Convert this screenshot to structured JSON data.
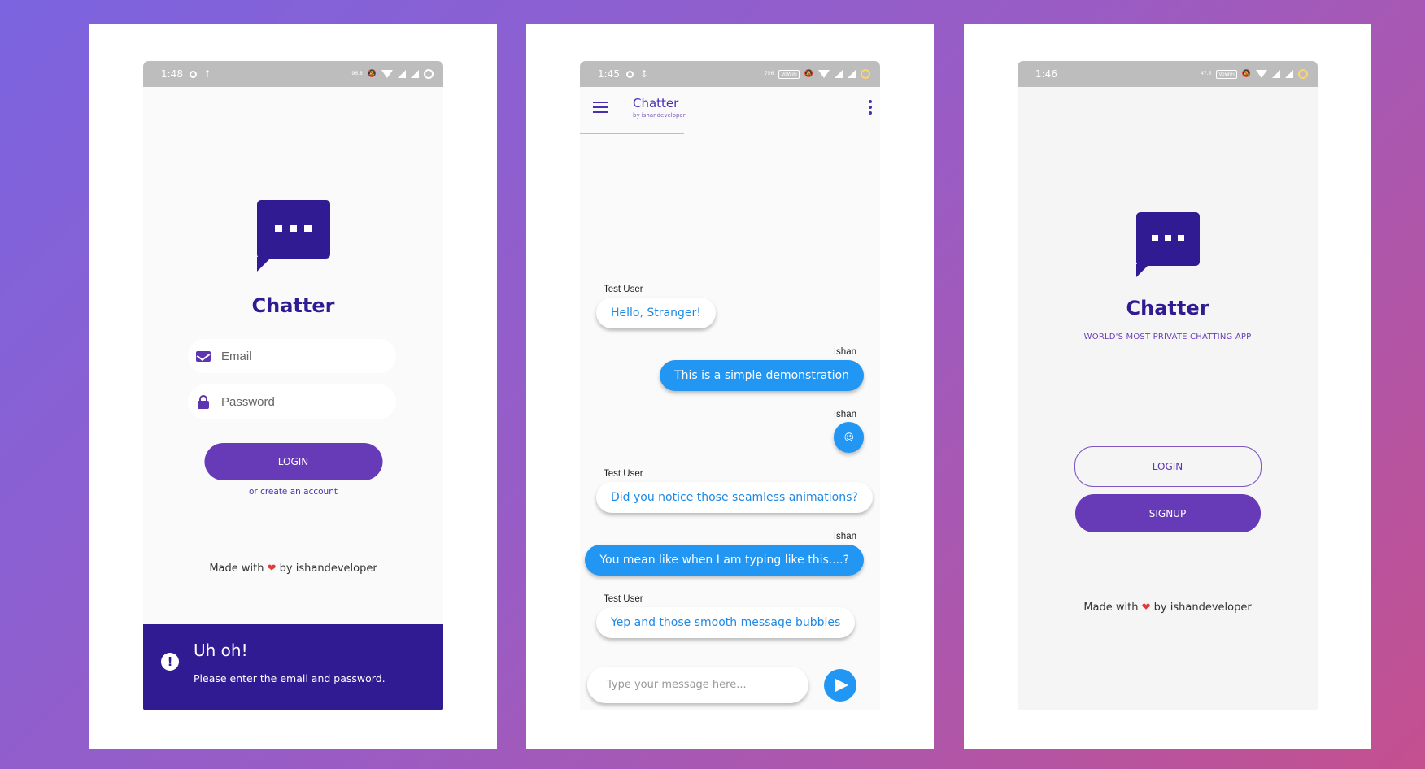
{
  "login_screen": {
    "status_time": "1:48",
    "status_net": "96.8",
    "app_title": "Chatter",
    "email_placeholder": "Email",
    "password_placeholder": "Password",
    "login_button": "LOGIN",
    "create_account_link": "or create an account",
    "footer_prefix": "Made with",
    "footer_heart": "❤",
    "footer_suffix": "by ishandeveloper",
    "snackbar_title": "Uh oh!",
    "snackbar_message": "Please enter the email and password.",
    "snackbar_icon": "!"
  },
  "chat_screen": {
    "status_time": "1:45",
    "status_net": "756",
    "status_vowifi": "VoWiFi",
    "app_title": "Chatter",
    "app_subtitle": "by ishandeveloper",
    "messages": [
      {
        "sender": "Test User",
        "text": "Hello, Stranger!",
        "direction": "in"
      },
      {
        "sender": "Ishan",
        "text": "This is a simple demonstration",
        "direction": "out"
      },
      {
        "sender": "Ishan",
        "text": "😉",
        "direction": "out"
      },
      {
        "sender": "Test User",
        "text": "Did you notice those seamless animations?",
        "direction": "in"
      },
      {
        "sender": "Ishan",
        "text": "You mean like when I am typing like this....?",
        "direction": "out"
      },
      {
        "sender": "Test User",
        "text": "Yep and those smooth message bubbles",
        "direction": "in"
      }
    ],
    "composer_placeholder": "Type your message here..."
  },
  "welcome_screen": {
    "status_time": "1:46",
    "status_net": "47.5",
    "status_vowifi": "VoWiFi",
    "app_title": "Chatter",
    "tagline": "WORLD'S MOST PRIVATE CHATTING APP",
    "login_button": "LOGIN",
    "signup_button": "SIGNUP",
    "footer_prefix": "Made with",
    "footer_heart": "❤",
    "footer_suffix": "by ishandeveloper"
  },
  "colors": {
    "primary": "#673ab7",
    "primary_dark": "#311b92",
    "accent_blue": "#2196f3",
    "heart": "#e53935"
  },
  "icons": [
    "email-icon",
    "lock-icon",
    "alert-icon",
    "menu-icon",
    "more-vert-icon",
    "send-icon",
    "chat-logo-icon"
  ]
}
